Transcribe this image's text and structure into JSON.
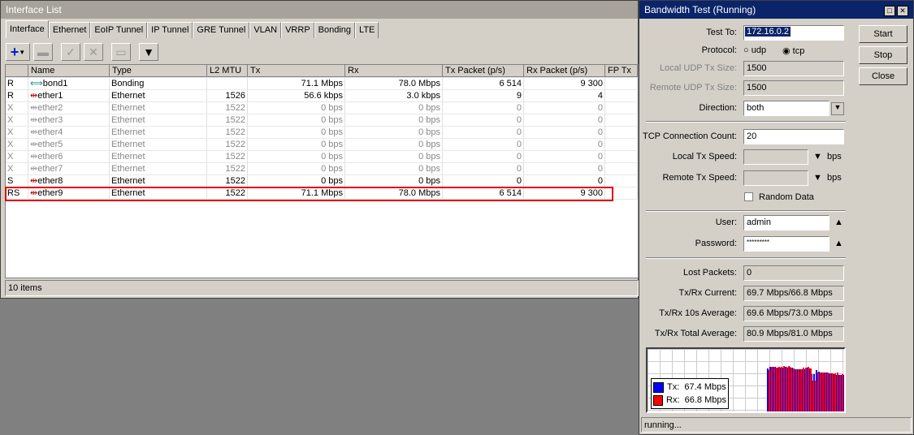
{
  "iflist": {
    "title": "Interface List",
    "tabs": [
      "Interface",
      "Ethernet",
      "EoIP Tunnel",
      "IP Tunnel",
      "GRE Tunnel",
      "VLAN",
      "VRRP",
      "Bonding",
      "LTE"
    ],
    "columns": [
      "",
      "Name",
      "Type",
      "L2 MTU",
      "Tx",
      "Rx",
      "Tx Packet (p/s)",
      "Rx Packet (p/s)",
      "FP Tx"
    ],
    "rows": [
      [
        "R",
        "bond1",
        "Bonding",
        "",
        "71.1 Mbps",
        "78.0 Mbps",
        "6 514",
        "9 300"
      ],
      [
        "R",
        "ether1",
        "Ethernet",
        "1526",
        "56.6 kbps",
        "3.0 kbps",
        "9",
        "4"
      ],
      [
        "X",
        "ether2",
        "Ethernet",
        "1522",
        "0 bps",
        "0 bps",
        "0",
        "0"
      ],
      [
        "X",
        "ether3",
        "Ethernet",
        "1522",
        "0 bps",
        "0 bps",
        "0",
        "0"
      ],
      [
        "X",
        "ether4",
        "Ethernet",
        "1522",
        "0 bps",
        "0 bps",
        "0",
        "0"
      ],
      [
        "X",
        "ether5",
        "Ethernet",
        "1522",
        "0 bps",
        "0 bps",
        "0",
        "0"
      ],
      [
        "X",
        "ether6",
        "Ethernet",
        "1522",
        "0 bps",
        "0 bps",
        "0",
        "0"
      ],
      [
        "X",
        "ether7",
        "Ethernet",
        "1522",
        "0 bps",
        "0 bps",
        "0",
        "0"
      ],
      [
        "S",
        "ether8",
        "Ethernet",
        "1522",
        "0 bps",
        "0 bps",
        "0",
        "0"
      ],
      [
        "RS",
        "ether9",
        "Ethernet",
        "1522",
        "71.1 Mbps",
        "78.0 Mbps",
        "6 514",
        "9 300"
      ]
    ],
    "status": "10 items"
  },
  "bw": {
    "title": "Bandwidth Test (Running)",
    "test_to_label": "Test To:",
    "test_to": "172.16.0.2",
    "protocol_label": "Protocol:",
    "udp": "udp",
    "tcp": "tcp",
    "local_udp_label": "Local UDP Tx Size:",
    "local_udp": "1500",
    "remote_udp_label": "Remote UDP Tx Size:",
    "remote_udp": "1500",
    "direction_label": "Direction:",
    "direction": "both",
    "tcp_count_label": "TCP Connection Count:",
    "tcp_count": "20",
    "local_speed_label": "Local Tx Speed:",
    "remote_speed_label": "Remote Tx Speed:",
    "bps": "bps",
    "random_data": "Random Data",
    "user_label": "User:",
    "user": "admin",
    "password_label": "Password:",
    "password": "*********",
    "lost_label": "Lost Packets:",
    "lost": "0",
    "cur_label": "Tx/Rx Current:",
    "cur": "69.7 Mbps/66.8 Mbps",
    "avg10_label": "Tx/Rx 10s Average:",
    "avg10": "69.6 Mbps/73.0 Mbps",
    "total_label": "Tx/Rx Total Average:",
    "total": "80.9 Mbps/81.0 Mbps",
    "start": "Start",
    "stop": "Stop",
    "close": "Close",
    "status": "running...",
    "legend_tx": "Tx:  67.4 Mbps",
    "legend_rx": "Rx:  66.8 Mbps",
    "colors": {
      "tx": "#0000ff",
      "rx": "#ff0000"
    },
    "chart_data": {
      "type": "bar",
      "series": [
        {
          "name": "Tx",
          "values": [
            69,
            72,
            71,
            71,
            70,
            70,
            70,
            71,
            70,
            72,
            70,
            68,
            67,
            68,
            68,
            68,
            70,
            69,
            60,
            60,
            66,
            64,
            63,
            62,
            62,
            61,
            61,
            60,
            59,
            58,
            59,
            58
          ]
        },
        {
          "name": "Rx",
          "values": [
            66,
            71,
            71,
            70,
            71,
            71,
            73,
            71,
            73,
            70,
            69,
            67,
            68,
            68,
            70,
            70,
            72,
            69,
            50,
            50,
            63,
            62,
            62,
            63,
            62,
            61,
            61,
            61,
            62,
            58,
            60,
            58
          ]
        }
      ]
    }
  }
}
